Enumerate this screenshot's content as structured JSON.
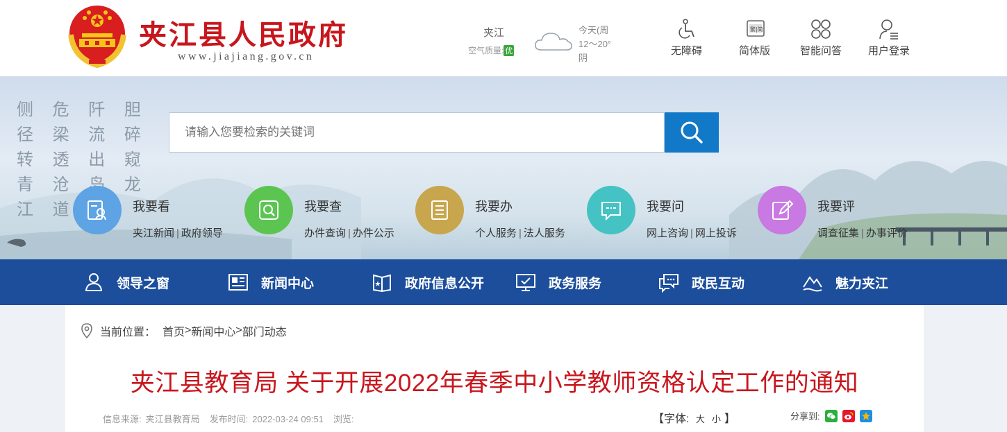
{
  "header": {
    "site_title": "夹江县人民政府",
    "site_url": "www.jiajiang.gov.cn",
    "weather": {
      "city": "夹江",
      "air_quality_label": "空气质量:",
      "air_quality_value": "优",
      "day": "今天(周",
      "temp": "12～20°",
      "condition": "阴",
      "icon": "cloud-icon"
    },
    "links": [
      {
        "label": "无障碍",
        "icon": "accessibility-icon"
      },
      {
        "label": "简体版",
        "icon": "simplified-chinese-icon"
      },
      {
        "label": "智能问答",
        "icon": "smart-qa-icon"
      },
      {
        "label": "用户登录",
        "icon": "user-login-icon"
      }
    ]
  },
  "banner": {
    "poem_lines": [
      "侧 危 阡 胆",
      "径 梁 流 碎",
      "转 透 出 窥",
      "青 沧 岛 龙",
      "江 道 渴"
    ]
  },
  "search": {
    "placeholder": "请输入您要检索的关键词",
    "icon": "search-icon"
  },
  "services": [
    {
      "title": "我要看",
      "links": [
        "夹江新闻",
        "政府领导"
      ],
      "color": "#5ea3e4",
      "icon": "read-icon"
    },
    {
      "title": "我要查",
      "links": [
        "办件查询",
        "办件公示"
      ],
      "color": "#5cc552",
      "icon": "query-icon"
    },
    {
      "title": "我要办",
      "links": [
        "个人服务",
        "法人服务"
      ],
      "color": "#c7a64d",
      "icon": "handle-icon"
    },
    {
      "title": "我要问",
      "links": [
        "网上咨询",
        "网上投诉"
      ],
      "color": "#44c2c4",
      "icon": "ask-icon"
    },
    {
      "title": "我要评",
      "links": [
        "调查征集",
        "办事评价"
      ],
      "color": "#c879e2",
      "icon": "evaluate-icon"
    }
  ],
  "nav": [
    {
      "label": "领导之窗",
      "icon": "leader-icon"
    },
    {
      "label": "新闻中心",
      "icon": "news-icon"
    },
    {
      "label": "政府信息公开",
      "icon": "info-disclosure-icon"
    },
    {
      "label": "政务服务",
      "icon": "gov-service-icon"
    },
    {
      "label": "政民互动",
      "icon": "interaction-icon"
    },
    {
      "label": "魅力夹江",
      "icon": "charm-icon"
    }
  ],
  "breadcrumb": {
    "label": "当前位置：",
    "items": [
      "首页",
      "新闻中心",
      "部门动态"
    ],
    "separator": ">"
  },
  "article": {
    "title": "夹江县教育局 关于开展2022年春季中小学教师资格认定工作的通知",
    "source_label": "信息来源:",
    "source": "夹江县教育局",
    "date_label": "发布时间:",
    "date": "2022-03-24 09:51",
    "views_label": "浏览:",
    "font_label_open": "【字体:",
    "font_large": "大",
    "font_small": "小",
    "font_label_close": "】",
    "share_label": "分享到:",
    "share_targets": [
      {
        "icon": "wechat-icon",
        "color": "#2aae3f"
      },
      {
        "icon": "weibo-icon",
        "color": "#e6162d"
      },
      {
        "icon": "qzone-icon",
        "color": "#f7b500"
      }
    ]
  }
}
